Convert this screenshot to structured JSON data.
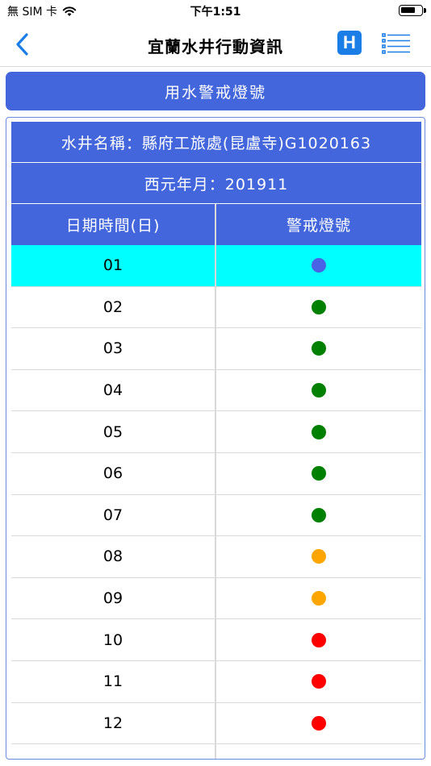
{
  "status_bar": {
    "carrier": "無 SIM 卡",
    "time": "下午1:51",
    "battery_level": 0.75
  },
  "nav": {
    "title": "宜蘭水井行動資訊",
    "back_icon": "chevron-left-icon",
    "h_label": "H",
    "menu_icon": "list-icon"
  },
  "section": {
    "title": "用水警戒燈號"
  },
  "table": {
    "well_name": "水井名稱：縣府工旅處(昆盧寺)G1020163",
    "year_month": "西元年月：201911",
    "col_day": "日期時間(日)",
    "col_signal": "警戒燈號",
    "rows": [
      {
        "day": "01",
        "color": "#4a63e6",
        "active": true
      },
      {
        "day": "02",
        "color": "#008000",
        "active": false
      },
      {
        "day": "03",
        "color": "#008000",
        "active": false
      },
      {
        "day": "04",
        "color": "#008000",
        "active": false
      },
      {
        "day": "05",
        "color": "#008000",
        "active": false
      },
      {
        "day": "06",
        "color": "#008000",
        "active": false
      },
      {
        "day": "07",
        "color": "#008000",
        "active": false
      },
      {
        "day": "08",
        "color": "#ffa500",
        "active": false
      },
      {
        "day": "09",
        "color": "#ffa500",
        "active": false
      },
      {
        "day": "10",
        "color": "#ff0000",
        "active": false
      },
      {
        "day": "11",
        "color": "#ff0000",
        "active": false
      },
      {
        "day": "12",
        "color": "#ff0000",
        "active": false
      },
      {
        "day": "",
        "color": "",
        "active": false
      }
    ]
  },
  "colors": {
    "accent": "#4466dd",
    "highlight": "#00ffff",
    "nav_blue": "#1a7ee6"
  }
}
